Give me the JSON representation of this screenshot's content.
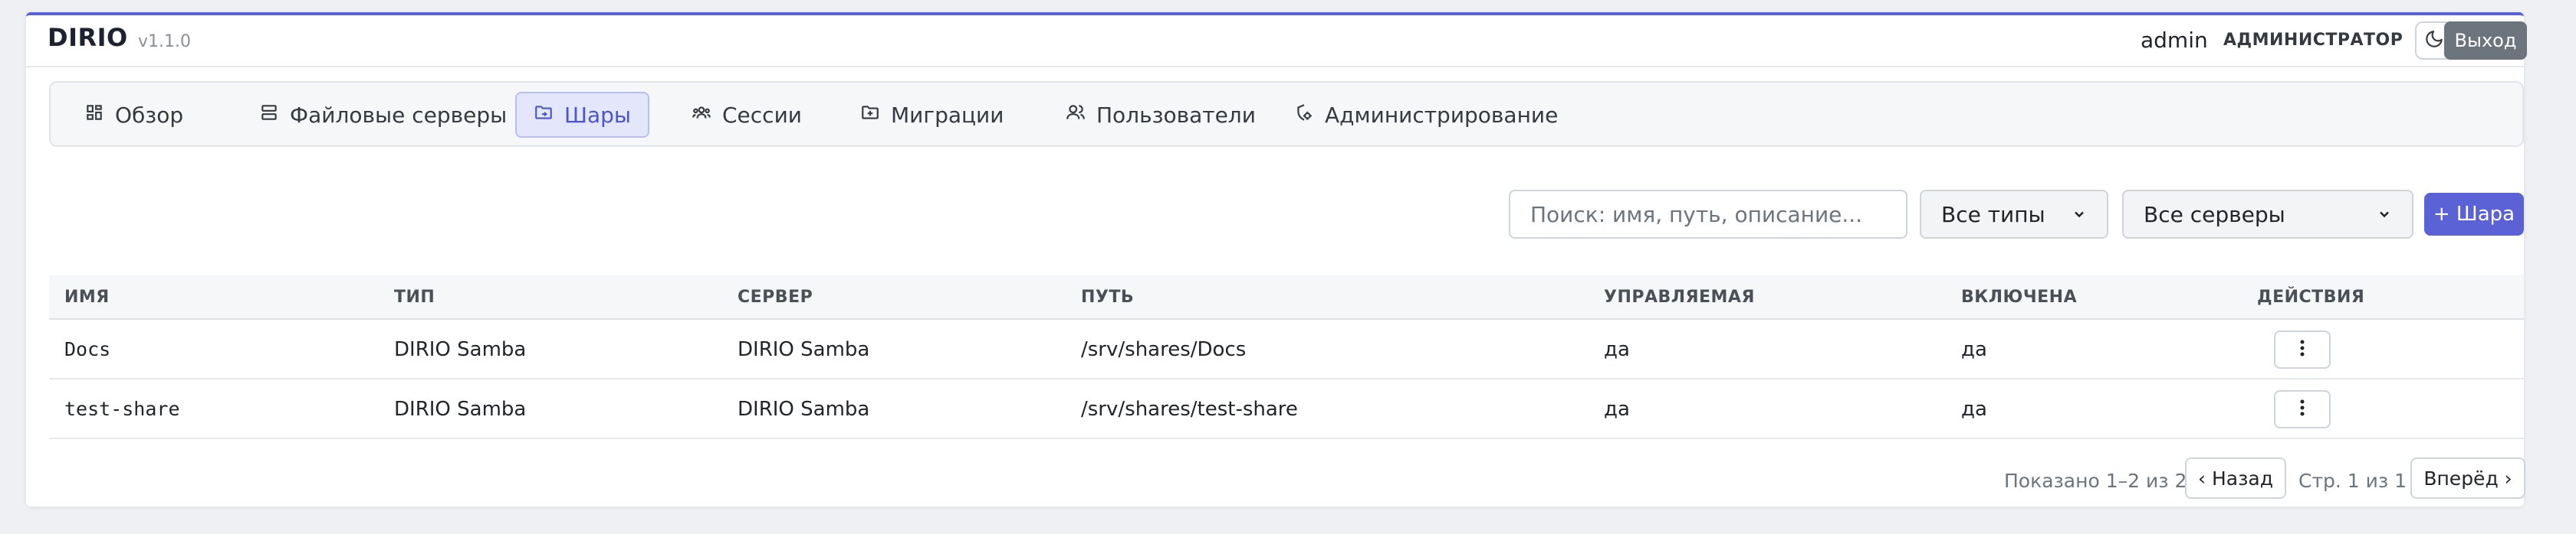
{
  "app": {
    "brand": "DIRIO",
    "version": "v1.1.0"
  },
  "header": {
    "user": "admin",
    "role": "АДМИНИСТРАТОР",
    "theme_icon": "moon-icon",
    "logout_label": "Выход"
  },
  "nav": [
    {
      "label": "Обзор",
      "icon": "dashboard-icon"
    },
    {
      "label": "Файловые серверы",
      "icon": "server-icon"
    },
    {
      "label": "Шары",
      "icon": "folder-share-icon",
      "active": true
    },
    {
      "label": "Сессии",
      "icon": "users-group-icon"
    },
    {
      "label": "Миграции",
      "icon": "folder-move-icon"
    },
    {
      "label": "Пользователи",
      "icon": "user-icon"
    },
    {
      "label": "Администрирование",
      "icon": "admin-icon"
    }
  ],
  "toolbar": {
    "search_placeholder": "Поиск: имя, путь, описание...",
    "type_filter": "Все типы",
    "server_filter": "Все серверы",
    "add_label": "+ Шара"
  },
  "table": {
    "headers": [
      "ИМЯ",
      "ТИП",
      "СЕРВЕР",
      "ПУТЬ",
      "УПРАВЛЯЕМАЯ",
      "ВКЛЮЧЕНА",
      "ДЕЙСТВИЯ"
    ],
    "rows": [
      {
        "name": "Docs",
        "type": "DIRIO Samba",
        "server": "DIRIO Samba",
        "path": "/srv/shares/Docs",
        "managed": "да",
        "enabled": "да"
      },
      {
        "name": "test-share",
        "type": "DIRIO Samba",
        "server": "DIRIO Samba",
        "path": "/srv/shares/test-share",
        "managed": "да",
        "enabled": "да"
      }
    ]
  },
  "pagination": {
    "shown": "Показано 1–2 из 2",
    "prev": "‹ Назад",
    "page": "Стр. 1 из 1",
    "next": "Вперёд ›"
  },
  "colors": {
    "accent": "#5b62d6",
    "muted": "#6c757d"
  }
}
